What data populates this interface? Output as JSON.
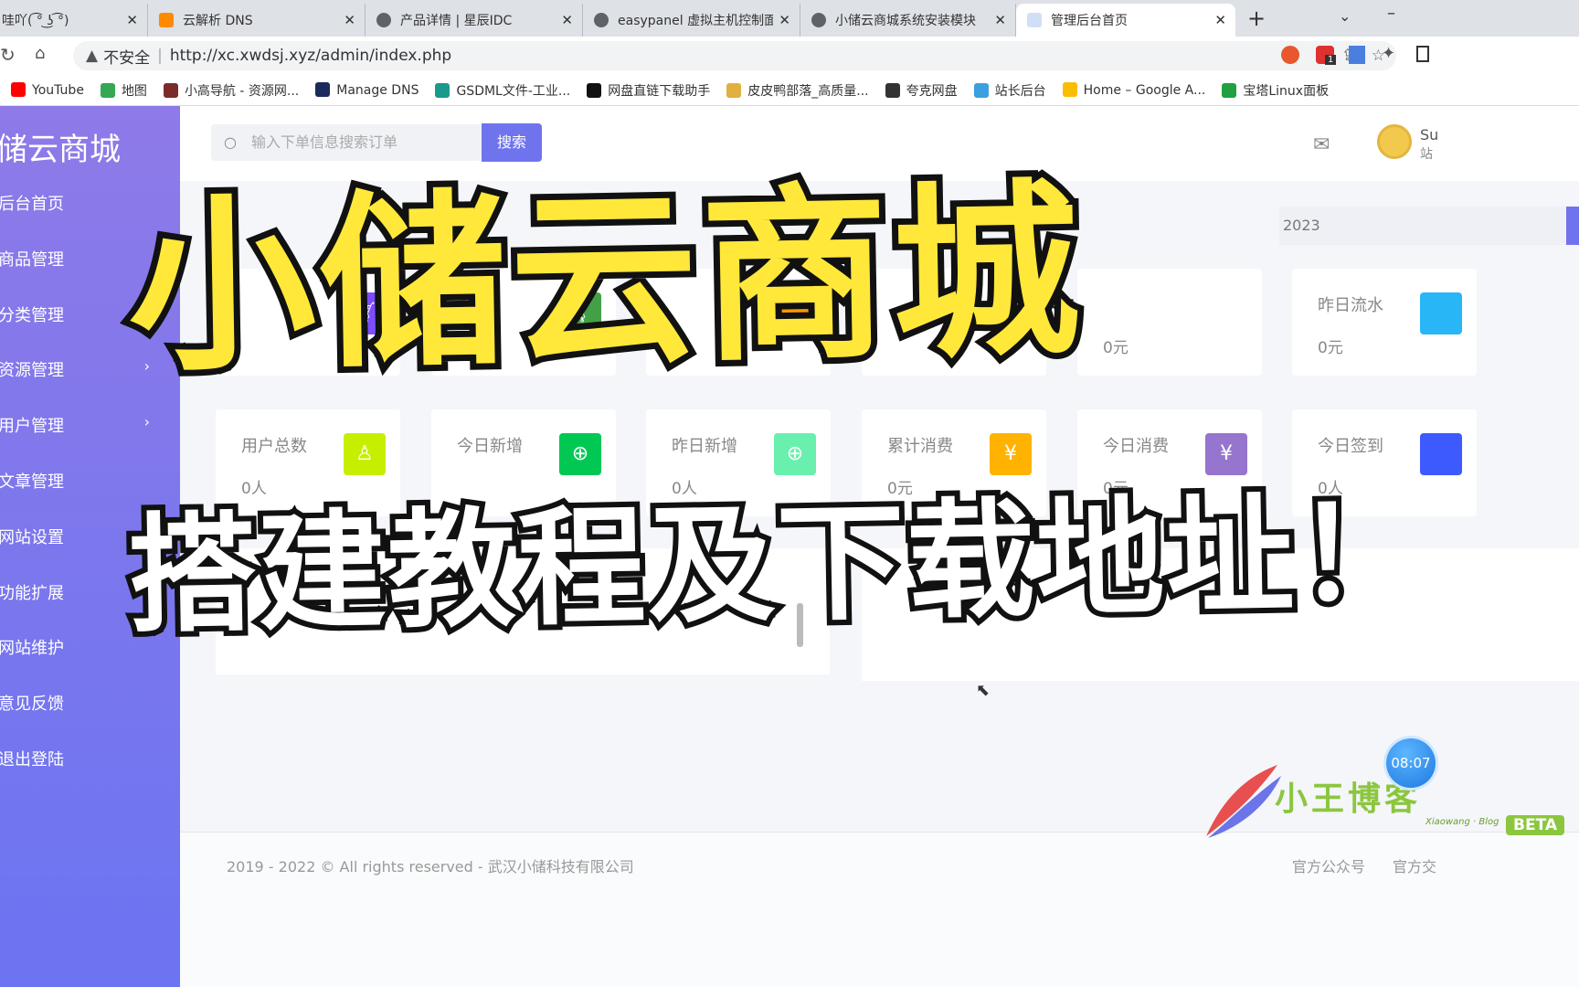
{
  "browser": {
    "tabs": [
      {
        "title": "哇吖( ͡° ͜ʖ ͡°)"
      },
      {
        "title": "云解析 DNS"
      },
      {
        "title": "产品详情 | 星辰IDC"
      },
      {
        "title": "easypanel 虚拟主机控制面"
      },
      {
        "title": "小储云商城系统安装模块"
      },
      {
        "title": "管理后台首页",
        "active": true
      }
    ],
    "security": "不安全",
    "url": "http://xc.xwdsj.xyz/admin/index.php",
    "bookmarks": [
      {
        "label": "YouTube",
        "color": "#ff0000"
      },
      {
        "label": "地图",
        "color": "#34a853"
      },
      {
        "label": "小高导航 - 资源网...",
        "color": "#7a2b2b"
      },
      {
        "label": "Manage DNS",
        "color": "#1a2a5a"
      },
      {
        "label": "GSDML文件-工业...",
        "color": "#1a9a8a"
      },
      {
        "label": "网盘直链下载助手",
        "color": "#111111"
      },
      {
        "label": "皮皮鸭部落_高质量...",
        "color": "#e0b040"
      },
      {
        "label": "夸克网盘",
        "color": "#333333"
      },
      {
        "label": "站长后台",
        "color": "#3aa0e0"
      },
      {
        "label": "Home – Google A...",
        "color": "#fbbc04"
      },
      {
        "label": "宝塔Linux面板",
        "color": "#20a040"
      }
    ],
    "extension_badge": "1"
  },
  "sidebar": {
    "logo": "储云商城",
    "items": [
      {
        "label": "后台首页"
      },
      {
        "label": "商品管理"
      },
      {
        "label": "分类管理",
        "chevron": true
      },
      {
        "label": "资源管理",
        "chevron": true
      },
      {
        "label": "用户管理",
        "chevron": true
      },
      {
        "label": "文章管理"
      },
      {
        "label": "网站设置"
      },
      {
        "label": "功能扩展"
      },
      {
        "label": "网站维护"
      },
      {
        "label": "意见反馈"
      },
      {
        "label": "退出登陆"
      }
    ]
  },
  "header": {
    "search_placeholder": "输入下单信息搜索订单",
    "search_button": "搜索",
    "user_initial": "Su",
    "user_role": "站"
  },
  "date_fragment": "2023",
  "stats_row1": [
    {
      "label": "",
      "value": "",
      "color": "#7c4dff",
      "icon": "cart-icon"
    },
    {
      "label": "",
      "value": "",
      "color": "#43a047",
      "icon": "cart-icon"
    },
    {
      "label": "",
      "value": "",
      "color": "#ff9800",
      "icon": ""
    },
    {
      "label": "",
      "value": "",
      "color": "",
      "icon": ""
    },
    {
      "label": "",
      "value": "0元",
      "color": "",
      "icon": ""
    },
    {
      "label": "昨日流水",
      "value": "0元",
      "color": "#29b6f6",
      "icon": ""
    }
  ],
  "stats_row2": [
    {
      "label": "用户总数",
      "value": "0人",
      "color": "#c6ef00",
      "icon": "user-icon"
    },
    {
      "label": "今日新增",
      "value": "",
      "color": "#00c853",
      "icon": "plus-icon"
    },
    {
      "label": "昨日新增",
      "value": "0人",
      "color": "#69f0ae",
      "icon": "plus-icon"
    },
    {
      "label": "累计消费",
      "value": "0元",
      "color": "#ffb300",
      "icon": "yen-icon"
    },
    {
      "label": "今日消费",
      "value": "0元",
      "color": "#9575cd",
      "icon": "yen-icon"
    },
    {
      "label": "今日签到",
      "value": "0人",
      "color": "#3d5afe",
      "icon": ""
    }
  ],
  "footer": {
    "copyright": "2019 - 2022 © All rights reserved - 武汉小储科技有限公司",
    "links": [
      "官方公众号",
      "官方交"
    ]
  },
  "overlay": {
    "title": "小储云商城",
    "subtitle": "搭建教程及下载地址！"
  },
  "watermark": {
    "brand": "小王博客",
    "sub": "Xiaowang · Blog",
    "badge": "BETA",
    "clock": "08:07"
  }
}
